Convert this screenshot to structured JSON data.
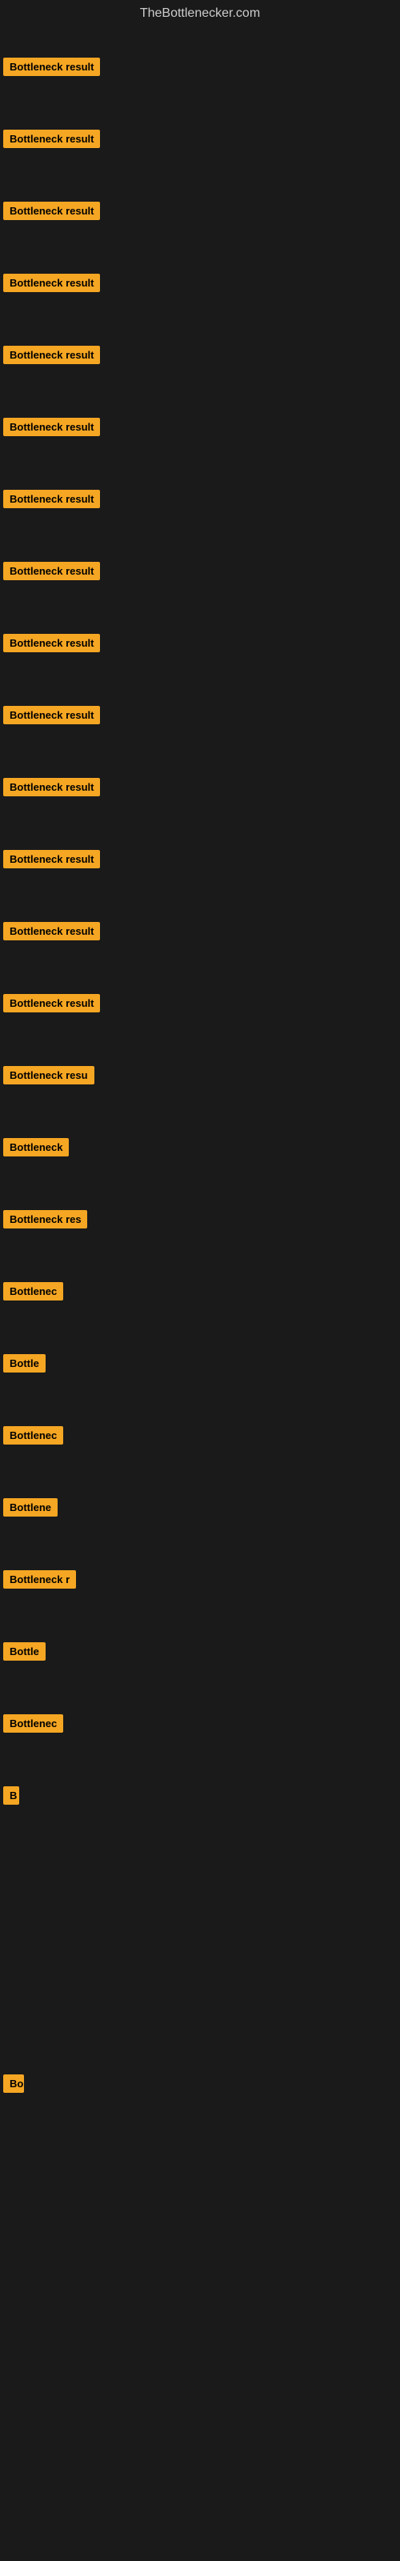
{
  "site": {
    "title": "TheBottlenecker.com"
  },
  "items": [
    {
      "id": 1,
      "label": "Bottleneck result",
      "width": 140,
      "spacing": "lg"
    },
    {
      "id": 2,
      "label": "Bottleneck result",
      "width": 140,
      "spacing": "lg"
    },
    {
      "id": 3,
      "label": "Bottleneck result",
      "width": 140,
      "spacing": "lg"
    },
    {
      "id": 4,
      "label": "Bottleneck result",
      "width": 140,
      "spacing": "lg"
    },
    {
      "id": 5,
      "label": "Bottleneck result",
      "width": 140,
      "spacing": "lg"
    },
    {
      "id": 6,
      "label": "Bottleneck result",
      "width": 140,
      "spacing": "lg"
    },
    {
      "id": 7,
      "label": "Bottleneck result",
      "width": 140,
      "spacing": "lg"
    },
    {
      "id": 8,
      "label": "Bottleneck result",
      "width": 140,
      "spacing": "lg"
    },
    {
      "id": 9,
      "label": "Bottleneck result",
      "width": 140,
      "spacing": "lg"
    },
    {
      "id": 10,
      "label": "Bottleneck result",
      "width": 140,
      "spacing": "lg"
    },
    {
      "id": 11,
      "label": "Bottleneck result",
      "width": 140,
      "spacing": "lg"
    },
    {
      "id": 12,
      "label": "Bottleneck result",
      "width": 140,
      "spacing": "lg"
    },
    {
      "id": 13,
      "label": "Bottleneck result",
      "width": 140,
      "spacing": "lg"
    },
    {
      "id": 14,
      "label": "Bottleneck result",
      "width": 140,
      "spacing": "lg"
    },
    {
      "id": 15,
      "label": "Bottleneck resu",
      "width": 118,
      "spacing": "lg"
    },
    {
      "id": 16,
      "label": "Bottleneck",
      "width": 85,
      "spacing": "lg"
    },
    {
      "id": 17,
      "label": "Bottleneck res",
      "width": 105,
      "spacing": "lg"
    },
    {
      "id": 18,
      "label": "Bottlenec",
      "width": 75,
      "spacing": "lg"
    },
    {
      "id": 19,
      "label": "Bottle",
      "width": 55,
      "spacing": "lg"
    },
    {
      "id": 20,
      "label": "Bottlenec",
      "width": 75,
      "spacing": "lg"
    },
    {
      "id": 21,
      "label": "Bottlene",
      "width": 68,
      "spacing": "lg"
    },
    {
      "id": 22,
      "label": "Bottleneck r",
      "width": 92,
      "spacing": "lg"
    },
    {
      "id": 23,
      "label": "Bottle",
      "width": 55,
      "spacing": "lg"
    },
    {
      "id": 24,
      "label": "Bottlenec",
      "width": 75,
      "spacing": "lg"
    },
    {
      "id": 25,
      "label": "B",
      "width": 20,
      "spacing": "lg"
    },
    {
      "id": 26,
      "label": "",
      "width": 0,
      "spacing": "xlg"
    },
    {
      "id": 27,
      "label": "",
      "width": 0,
      "spacing": "xlg"
    },
    {
      "id": 28,
      "label": "",
      "width": 0,
      "spacing": "xlg"
    },
    {
      "id": 29,
      "label": "Bo",
      "width": 26,
      "spacing": "xlg"
    },
    {
      "id": 30,
      "label": "",
      "width": 0,
      "spacing": "xlg"
    },
    {
      "id": 31,
      "label": "",
      "width": 0,
      "spacing": "xlg"
    },
    {
      "id": 32,
      "label": "",
      "width": 0,
      "spacing": "xlg"
    }
  ]
}
